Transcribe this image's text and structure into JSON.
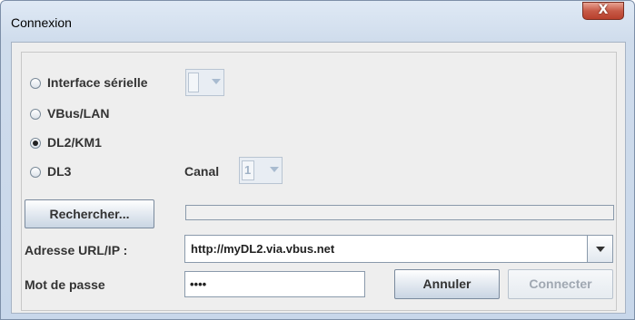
{
  "window": {
    "title": "Connexion",
    "close_label": "X"
  },
  "connection": {
    "options": [
      {
        "label": "Interface sérielle",
        "selected": false
      },
      {
        "label": "VBus/LAN",
        "selected": false
      },
      {
        "label": "DL2/KM1",
        "selected": true
      },
      {
        "label": "DL3",
        "selected": false
      }
    ],
    "serial_port_value": "",
    "canal_label": "Canal",
    "canal_value": "1"
  },
  "search": {
    "button_label": "Rechercher...",
    "progress_percent": 0
  },
  "address": {
    "label": "Adresse URL/IP :",
    "value": "http://myDL2.via.vbus.net"
  },
  "password": {
    "label": "Mot de passe",
    "value": "••••"
  },
  "actions": {
    "cancel_label": "Annuler",
    "connect_label": "Connecter"
  },
  "icons": [
    "close-icon",
    "radio-icon",
    "chevron-down-icon"
  ]
}
